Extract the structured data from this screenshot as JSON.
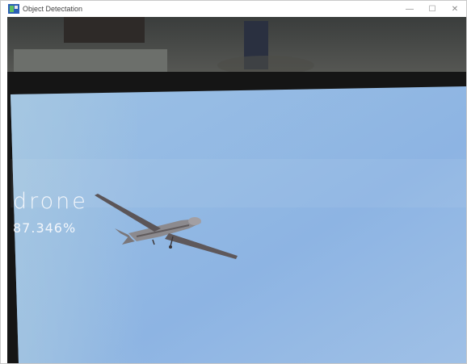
{
  "window": {
    "title": "Object Detectation",
    "controls": {
      "minimize": "—",
      "maximize": "☐",
      "close": "✕"
    }
  },
  "detection": {
    "label": "drone",
    "confidence": "87.346%"
  },
  "colors": {
    "screen": "#8fb5e0",
    "bezel": "#151515",
    "wall": "#4a4a4a"
  }
}
